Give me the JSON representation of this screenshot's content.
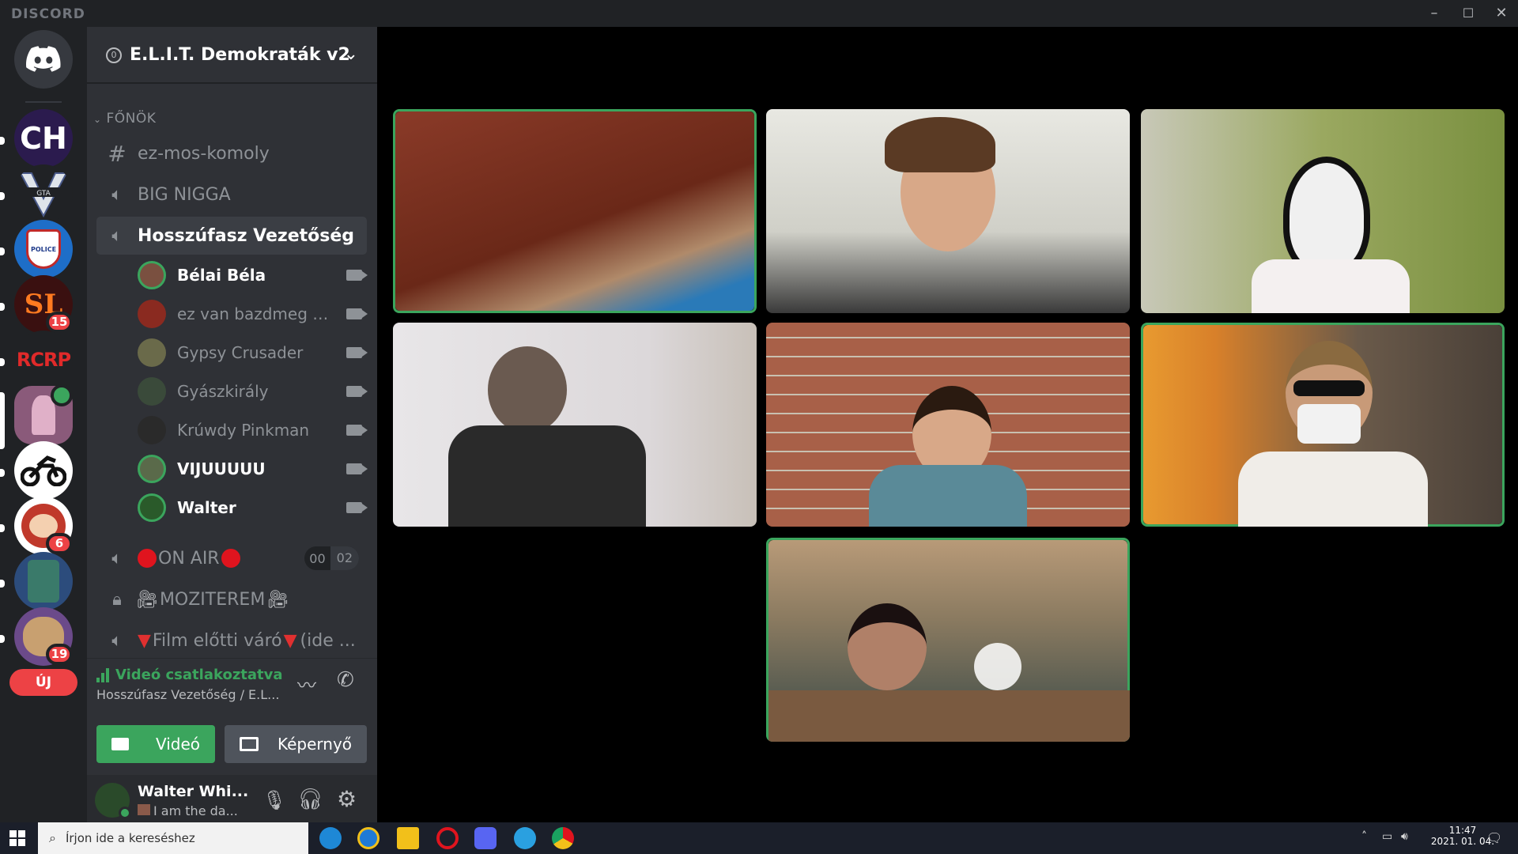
{
  "window": {
    "brand": "DISCORD",
    "controls": [
      "–",
      "☐",
      "✕"
    ]
  },
  "guilds": [
    {
      "label": "",
      "color": "#36393f"
    },
    {
      "label": "CH",
      "color": "#2b1b4e"
    },
    {
      "label": "GTA",
      "color": "#e8eef4"
    },
    {
      "label": "POLICE",
      "color": "#1e6ec8"
    },
    {
      "label": "SL",
      "color": "#3a1010",
      "badge": "15"
    },
    {
      "label": "RCRP",
      "color": "#202225"
    },
    {
      "label": "",
      "color": "#8a5a7a"
    },
    {
      "label": "",
      "color": "#ffffff"
    },
    {
      "label": "",
      "color": "#a8322a",
      "badge": "6"
    },
    {
      "label": "",
      "color": "#2c4c7c"
    },
    {
      "label": "",
      "color": "#6b4a8a",
      "badge": "19"
    }
  ],
  "new_label": "ÚJ",
  "server": {
    "name": "E.L.I.T. Demokraták v2"
  },
  "category": "FŐNÖK",
  "channels": {
    "text1": "ez-mos-komoly",
    "voice1": "BIG NIGGA",
    "voice2": "Hosszúfasz Vezetőség",
    "on_air_label": "ON AIR",
    "on_air_left": "00",
    "on_air_right": "02",
    "mozi": "MOZITEREM",
    "film": "Film előtti váró",
    "film_suffix": "(ide ..."
  },
  "voice_users": [
    {
      "name": "Bélai Béla",
      "active": true,
      "color": "#7a5040"
    },
    {
      "name": "ez van bazdmeg hát...",
      "active": false,
      "color": "#8a2a20"
    },
    {
      "name": "Gypsy Crusader",
      "active": false,
      "color": "#6a6a4a"
    },
    {
      "name": "Gyászkirály",
      "active": false,
      "color": "#3a4a3a"
    },
    {
      "name": "Krúwdy Pinkman",
      "active": false,
      "color": "#2a2a2a"
    },
    {
      "name": "VIJUUUUU",
      "active": true,
      "color": "#5a6a4a"
    },
    {
      "name": "Walter",
      "active": true,
      "color": "#2a5a2a"
    }
  ],
  "voice_panel": {
    "status": "Videó csatlakoztatva",
    "location": "Hosszúfasz Vezetőség / E.L...",
    "video_button": "Videó",
    "screen_button": "Képernyő"
  },
  "user_panel": {
    "name": "Walter Whi...",
    "status": "I am the da..."
  },
  "video_tiles": [
    {
      "speaking": true,
      "bg": "#7a3024"
    },
    {
      "speaking": false,
      "bg": "#d9d8d2"
    },
    {
      "speaking": false,
      "bg": "#8aa04a"
    },
    {
      "speaking": false,
      "bg": "#dad6d8"
    },
    {
      "speaking": false,
      "bg": "#a66048"
    },
    {
      "speaking": true,
      "bg": "#c88a3a"
    },
    {
      "speaking": true,
      "bg": "#8a7a60"
    }
  ],
  "taskbar": {
    "search_placeholder": "Írjon ide a kereséshez",
    "time": "11:47",
    "date": "2021. 01. 04."
  }
}
